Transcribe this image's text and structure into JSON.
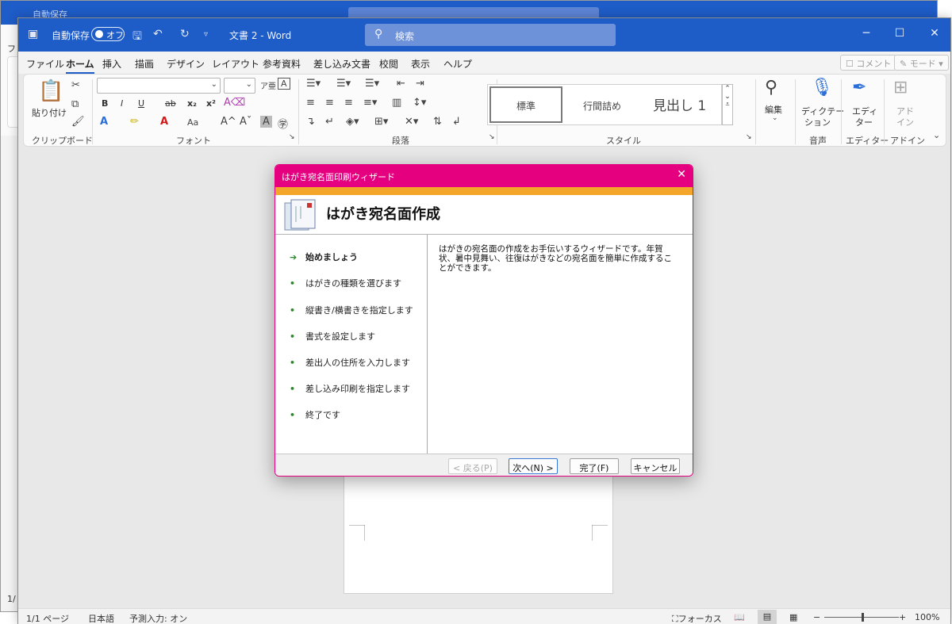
{
  "back_window": {
    "title_text": "自動保存",
    "left_text": "フ",
    "status_text": "1/"
  },
  "titlebar": {
    "autosave_label": "自動保存",
    "toggle_state": "オフ",
    "doc_title": "文書 2  -  Word",
    "search_placeholder": "検索",
    "minimize": "─",
    "maximize": "☐",
    "close": "✕"
  },
  "menu": {
    "items": [
      "ファイル",
      "ホーム",
      "挿入",
      "描画",
      "デザイン",
      "レイアウト",
      "参考資料",
      "差し込み文書",
      "校閲",
      "表示",
      "ヘルプ"
    ],
    "comment_btn": "コメント",
    "mode_btn": "モード"
  },
  "ribbon": {
    "paste_label": "貼り付け",
    "groups": {
      "clipboard": "クリップボード",
      "font": "フォント",
      "paragraph": "段落",
      "styles": "スタイル",
      "voice": "音声",
      "editor": "エディター",
      "addins": "アドイン"
    },
    "font_buttons": [
      "B",
      "I",
      "U",
      "ab",
      "x₂",
      "x²"
    ],
    "styles": [
      "標準",
      "行間詰め",
      "見出し 1"
    ],
    "edit_label": "編集",
    "dictate_label": "ディクテー",
    "dictate_label2": "ション",
    "editor_label": "エディ",
    "editor_label2": "ター",
    "addin_label": "アド",
    "addin_label2": "イン"
  },
  "dialog": {
    "title": "はがき宛名面印刷ウィザード",
    "close": "✕",
    "header": "はがき宛名面作成",
    "steps": [
      {
        "label": "始めましょう",
        "current": true
      },
      {
        "label": "はがきの種類を選びます",
        "current": false
      },
      {
        "label": "縦書き/横書きを指定します",
        "current": false
      },
      {
        "label": "書式を設定します",
        "current": false
      },
      {
        "label": "差出人の住所を入力します",
        "current": false
      },
      {
        "label": "差し込み印刷を指定します",
        "current": false
      },
      {
        "label": "終了です",
        "current": false
      }
    ],
    "description": "はがきの宛名面の作成をお手伝いするウィザードです。年賀状、暑中見舞い、往復はがきなどの宛名面を簡単に作成することができます。",
    "buttons": {
      "back": "< 戻る(P)",
      "next": "次へ(N) >",
      "finish": "完了(F)",
      "cancel": "キャンセル"
    }
  },
  "statusbar": {
    "page": "1/1 ページ",
    "language": "日本語",
    "predictive": "予測入力: オン",
    "focus": "フォーカス",
    "zoom_minus": "−",
    "zoom_plus": "+",
    "zoom": "100%",
    "zoom_level": 0.5
  },
  "colors": {
    "word_blue": "#1e5cc8",
    "dialog_magenta": "#e4007f",
    "dialog_orange": "#f4a62a"
  },
  "icons": [
    "word-app-icon",
    "save-icon",
    "undo-icon",
    "redo-icon",
    "search-icon",
    "paste-icon",
    "cut-icon",
    "copy-icon",
    "format-painter-icon",
    "find-icon",
    "microphone-icon",
    "editor-pen-icon",
    "addin-grid-icon",
    "wizard-postcard-icon",
    "arrow-right-icon",
    "bullet-icon"
  ]
}
